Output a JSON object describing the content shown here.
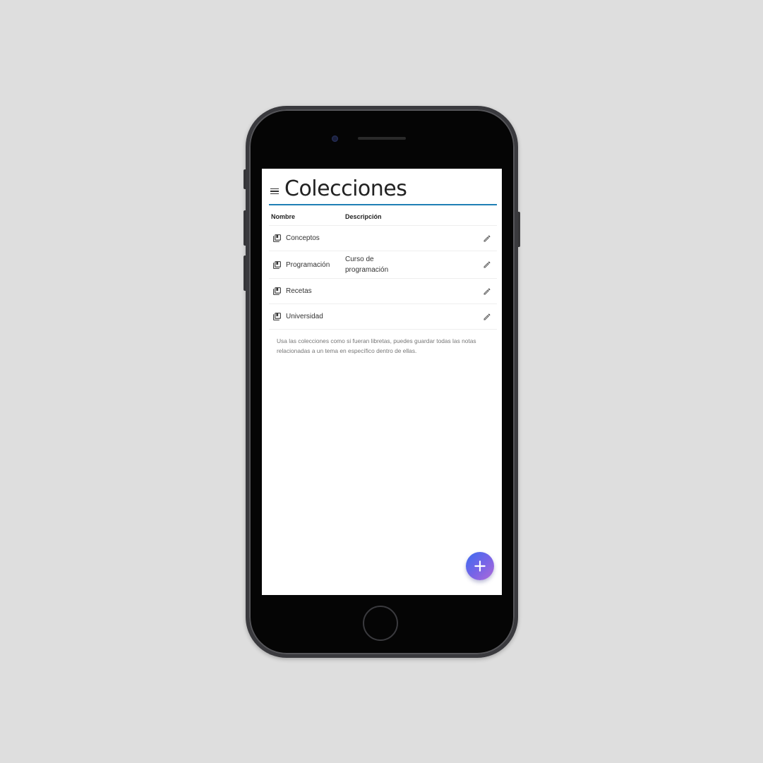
{
  "header": {
    "title": "Colecciones"
  },
  "table": {
    "columns": {
      "name": "Nombre",
      "description": "Descripción"
    },
    "rows": [
      {
        "name": "Conceptos",
        "description": ""
      },
      {
        "name": "Programación",
        "description": "Curso de programación"
      },
      {
        "name": "Recetas",
        "description": ""
      },
      {
        "name": "Universidad",
        "description": ""
      }
    ]
  },
  "help_text": "Usa las colecciones como si fueran libretas, puedes guardar todas las notas relacionadas a un tema en específico dentro de ellas.",
  "icons": {
    "menu": "menu-icon",
    "collection": "collection-bookmark-icon",
    "edit": "pencil-icon",
    "add": "plus-icon"
  },
  "colors": {
    "accent": "#1f7fb5",
    "fab_start": "#3c6cf0",
    "fab_end": "#b06ad8",
    "background": "#dedede"
  }
}
